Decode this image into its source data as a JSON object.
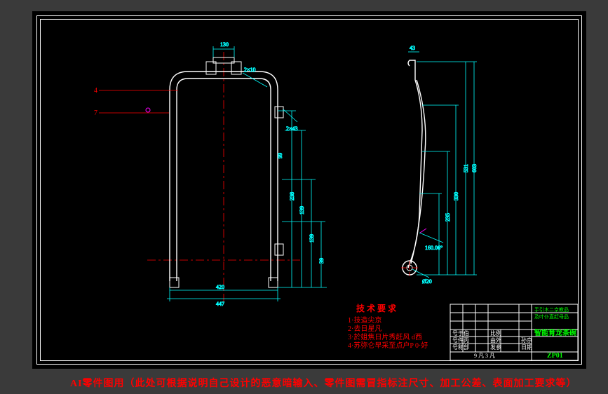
{
  "footer_note": "AI零件图用（此处可根据说明自己设计的恶意暗输入、零件图需冒指标注尺寸、加工公差、表面加工要求等）",
  "tech_req": {
    "title": "技 术 要 求",
    "lines": [
      "1·技造尖京",
      "2·去日星凡",
      "3·於姐焦日片秀赶风 d西",
      "4·苏弥仑早采至点户P 0·好"
    ]
  },
  "title_block": {
    "part_name": "智能育龙茶碗",
    "proj1": "手引木二京教品",
    "proj2": "及叶仆直赶母品",
    "code": "ZP01",
    "labels": {
      "scale": "比例",
      "draw_l": "号于伯",
      "by": "由外",
      "qty": "发参",
      "check": "号件丙",
      "date": "日期",
      "approve": "孙京",
      "sign": "号称部",
      "unit": "9 凡 3 凡"
    }
  },
  "dims_main": {
    "top": "130",
    "slot_w": "2×10",
    "slot_h": "2×43",
    "w1": "420",
    "w2": "447",
    "h1": "238",
    "h2": "139",
    "h3": "139",
    "h4": "39",
    "h5": "99"
  },
  "dims_side": {
    "top": "43",
    "h1": "603",
    "h2": "531",
    "h3": "330",
    "h4": "235",
    "ang": "160.06°",
    "hole": "Ø20"
  },
  "balloons": {
    "a": "4",
    "b": "7"
  }
}
